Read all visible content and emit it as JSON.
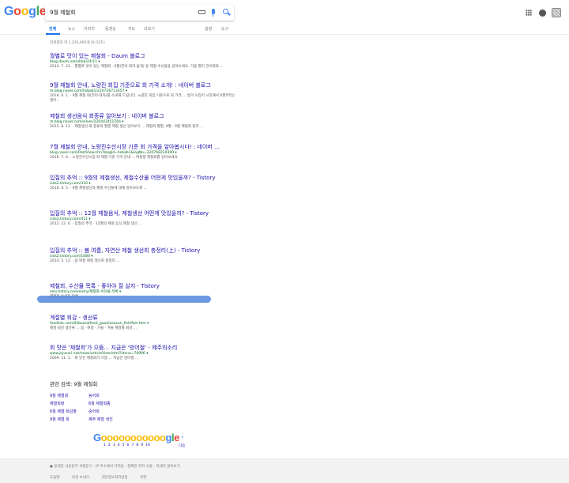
{
  "header": {
    "logo_letters": [
      "G",
      "o",
      "o",
      "g",
      "l",
      "e"
    ],
    "search_value": "9월 제철회",
    "icons": [
      "keyboard-icon",
      "mic-icon",
      "search-icon",
      "apps-icon",
      "notifications-icon",
      "avatar"
    ]
  },
  "tabs": [
    {
      "label": "전체",
      "active": true
    },
    {
      "label": "뉴스"
    },
    {
      "label": "이미지"
    },
    {
      "label": "동영상"
    },
    {
      "label": "지도"
    },
    {
      "label": "더보기"
    }
  ],
  "tools": {
    "settings": "설정",
    "tools": "도구"
  },
  "result_stats": "검색결과 약 1,220,000개 (0.52초)",
  "results": [
    {
      "title": "월별로 맛이 있는 제철회 - Daum 블로그",
      "url": "blog.daum.net/ohkb/24/11 ▾",
      "snip": "2014. 7. 23. · 월별로 맛이 있는 제철회 · 9월(전어·대하·꽃게) 등 제철 수산물을 알아보세요. 가을 별미 전어회와 ..."
    },
    {
      "title": "9월 제철회 안내, 노량진 회집 기준으로 회 가격 소개! : 네이버 블로그",
      "url": "m.blog.naver.com/hsbab1/220726713357 ▾",
      "snip": "2016. 6. 1. · 9월 제철 회(전어·대하)를 소개해 드립니다. 노량진 회집 기준으로 회 가격 ... 방어 오징어 시작해서 6월부터는 병어..."
    },
    {
      "title": "제철회 생선음식 회종류 알아보기 : 네이버 블로그",
      "url": "m.blog.naver.com/silver/220442451164 ▾",
      "snip": "2015. 8. 13. · 제철생선 회 종류와 월별 제철 생선 알아보기 ... 제철회 월별, 9월 · 9월 제철회 정리 ..."
    },
    {
      "title": "7월 제철회 안내, 노량진수산시장 기준 회 가격을 알아봅시다! : 네이버 ...",
      "url": "blog.naver.com/PostView.nhn?blogId=hsbab1&logNo=220768224390 ▾",
      "snip": "2016. 7. 6. · 노량진수산시장 회 제철 기준 가격 안내 ... 여름철 제철회를 알아보세요."
    },
    {
      "title": "입질의 추억 :: 9월의 제철생선, 제철수산물 어떤게 맛있을까? - Tistory",
      "url": "sids2.tistory.com/316 ▾",
      "snip": "2016. 9. 5. · 9월 제철생선과 제철 수산물에 대해 알아보도록 ..."
    },
    {
      "title": "입질의 추억 :: 12월 제철음식, 제철생선 어떤게 맛있을까? - Tistory",
      "url": "sids2.tistory.com/411 ▾",
      "snip": "2012. 12. 6. · 입질의 추억 · 12월의 제철 음식 제철 생선 ..."
    },
    {
      "title": "입질의 추억 :: 봄 여름, 자연산 제철 생선회 총정리(上) - Tistory",
      "url": "sids2.tistory.com/1680 ▾",
      "snip": "2014. 5. 12. · 봄 여름 제철 생선회 총정리 ..."
    },
    {
      "title": "제철회, 수산물 목록 - 좋아야 잘 살지 - Tistory",
      "url": "ezio.tistory.com/entry/제철회-수산물-목록 ▾",
      "snip": "제철회 수산물 목록 ..."
    },
    {
      "title": "계절별 회감 - 생선류",
      "url": "foodlink.com/03board/food_good/season_fish/fish.htm ▾",
      "snip": "제철 회감 생선류 ... 봄 · 여름 · 가을 · 겨울 계절별 회감 ..."
    },
    {
      "title": "회 맛은 '제철회'가 으뜸... 지금은 '방어철' - 제주의소리",
      "url": "www.jejusori.net/news/articleView.html?idxno=70906 ▾",
      "snip": "2009. 11. 1. · 회 맛은 제철회가 으뜸 ... 지금은 방어철 ..."
    }
  ],
  "related": {
    "title": "관련 검색: 9월 제철회",
    "items": [
      "9월 제철회",
      "제철회정",
      "6월 제철 회감출",
      "9월 제철 회",
      "농어회",
      "6월 제철회종",
      "숭어회",
      "제주 제철 생선"
    ]
  },
  "pager": {
    "pages": [
      "1",
      "2",
      "3",
      "4",
      "5",
      "6",
      "7",
      "8",
      "9",
      "10"
    ],
    "next": "다음"
  },
  "footer": {
    "location": "● 동대문 사동동부 서정문구 · IP 주소에서 가져옴 · 정확한 위치 사용 · 자세히 알아보기",
    "links": [
      "도움말",
      "의견 보내기",
      "개인정보처리방침",
      "약관"
    ]
  }
}
